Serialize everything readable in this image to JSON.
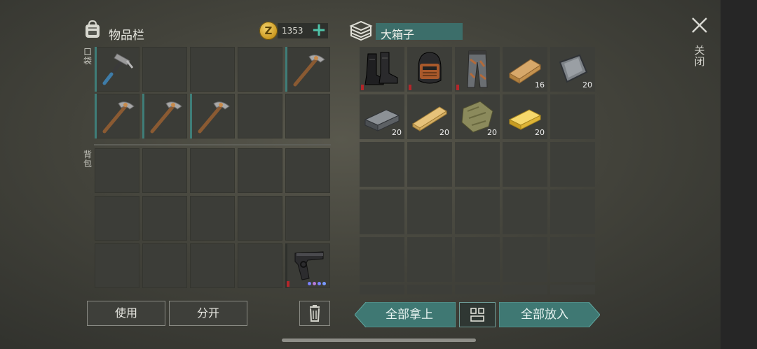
{
  "inventory": {
    "title": "物品栏",
    "coin_symbol": "Z",
    "coins": "1353",
    "pocket_label": "口袋",
    "backpack_label": "背包",
    "use_button": "使用",
    "split_button": "分开"
  },
  "box": {
    "title": "大箱子",
    "take_all_button": "全部拿上",
    "put_all_button": "全部放入"
  },
  "close_label": "关闭",
  "pocket_items": [
    "hammer",
    "",
    "",
    "",
    "pickaxe",
    "pickaxe",
    "pickaxe",
    "pickaxe",
    "",
    ""
  ],
  "backpack_items": [
    "",
    "",
    "",
    "",
    "",
    "",
    "",
    "",
    "",
    "",
    "",
    "",
    "",
    "",
    "pistol"
  ],
  "box_items": [
    {
      "icon": "boots-icon",
      "qty": ""
    },
    {
      "icon": "helmet-icon",
      "qty": ""
    },
    {
      "icon": "pants-icon",
      "qty": ""
    },
    {
      "icon": "wood-plank-icon",
      "qty": "16"
    },
    {
      "icon": "metal-plate-icon",
      "qty": "20"
    },
    {
      "icon": "iron-bar-icon",
      "qty": "20"
    },
    {
      "icon": "wood-beam-icon",
      "qty": "20"
    },
    {
      "icon": "cloth-icon",
      "qty": "20"
    },
    {
      "icon": "gold-bar-icon",
      "qty": "20"
    }
  ],
  "colors": {
    "accent": "#3f7873",
    "title_bg": "#3c6e6a",
    "plus": "#4fc3a8",
    "durability": "#b3262a"
  }
}
